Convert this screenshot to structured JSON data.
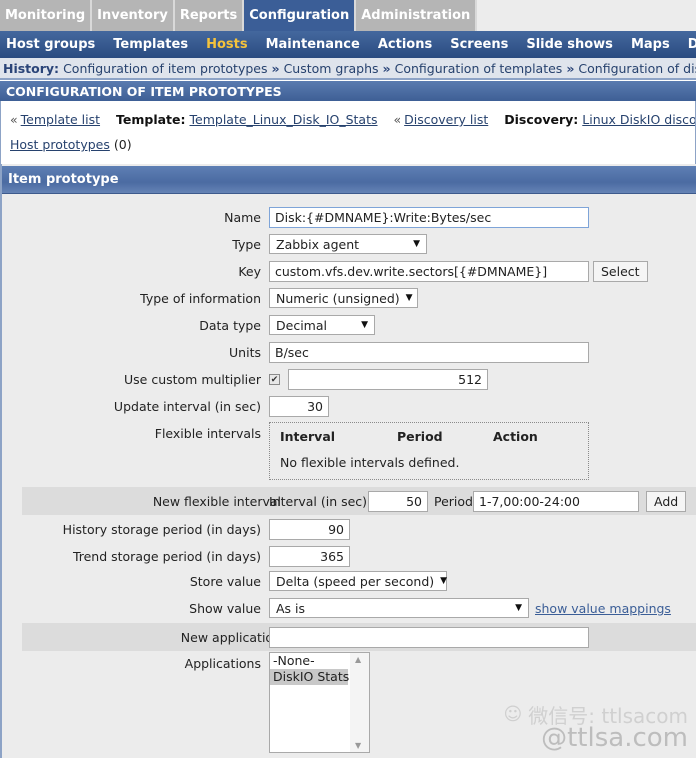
{
  "top_tabs": [
    {
      "label": "Monitoring",
      "active": false
    },
    {
      "label": "Inventory",
      "active": false
    },
    {
      "label": "Reports",
      "active": false
    },
    {
      "label": "Configuration",
      "active": true
    },
    {
      "label": "Administration",
      "active": false
    }
  ],
  "sub_nav": [
    {
      "label": "Host groups",
      "active": false
    },
    {
      "label": "Templates",
      "active": false
    },
    {
      "label": "Hosts",
      "active": true
    },
    {
      "label": "Maintenance",
      "active": false
    },
    {
      "label": "Actions",
      "active": false
    },
    {
      "label": "Screens",
      "active": false
    },
    {
      "label": "Slide shows",
      "active": false
    },
    {
      "label": "Maps",
      "active": false
    },
    {
      "label": "Discovery",
      "active": false
    }
  ],
  "history": {
    "label": "History:",
    "separator": "»",
    "items": [
      "Configuration of item prototypes",
      "Custom graphs",
      "Configuration of templates",
      "Configuration of discovery rules"
    ]
  },
  "section_title": "CONFIGURATION OF ITEM PROTOTYPES",
  "crumbs": {
    "back_arrow": "«",
    "template_list": "Template list",
    "template_label": "Template:",
    "template_value": "Template_Linux_Disk_IO_Stats",
    "discovery_list": "Discovery list",
    "discovery_label": "Discovery:",
    "discovery_value": "Linux DiskIO discovery",
    "host_prototypes": "Host prototypes",
    "host_prototypes_count": "(0)"
  },
  "form": {
    "title": "Item prototype",
    "name": {
      "label": "Name",
      "value": "Disk:{#DMNAME}:Write:Bytes/sec"
    },
    "type": {
      "label": "Type",
      "value": "Zabbix agent"
    },
    "key": {
      "label": "Key",
      "value": "custom.vfs.dev.write.sectors[{#DMNAME}]",
      "button": "Select"
    },
    "type_of_information": {
      "label": "Type of information",
      "value": "Numeric (unsigned)"
    },
    "data_type": {
      "label": "Data type",
      "value": "Decimal"
    },
    "units": {
      "label": "Units",
      "value": "B/sec"
    },
    "custom_multiplier": {
      "label": "Use custom multiplier",
      "checked": true,
      "check_glyph": "✔",
      "value": "512"
    },
    "update_interval": {
      "label": "Update interval (in sec)",
      "value": "30"
    },
    "flexible_intervals": {
      "label": "Flexible intervals",
      "columns": [
        "Interval",
        "Period",
        "Action"
      ],
      "empty_text": "No flexible intervals defined."
    },
    "new_flexible_interval": {
      "label": "New flexible interval",
      "interval_label": "Interval (in sec)",
      "interval_value": "50",
      "period_label": "Period",
      "period_value": "1-7,00:00-24:00",
      "add_button": "Add"
    },
    "history_storage": {
      "label": "History storage period (in days)",
      "value": "90"
    },
    "trend_storage": {
      "label": "Trend storage period (in days)",
      "value": "365"
    },
    "store_value": {
      "label": "Store value",
      "value": "Delta (speed per second)"
    },
    "show_value": {
      "label": "Show value",
      "value": "As is",
      "link": "show value mappings"
    },
    "new_application": {
      "label": "New application",
      "value": ""
    },
    "applications": {
      "label": "Applications",
      "options": [
        {
          "label": "-None-",
          "selected": false
        },
        {
          "label": "DiskIO Stats",
          "selected": true
        }
      ]
    }
  },
  "icons": {
    "caret": "▼",
    "scroll_up": "▲",
    "scroll_down": "▼"
  },
  "watermark": {
    "line1": "微信号: ttlsacom",
    "line2": "@ttlsa.com"
  }
}
